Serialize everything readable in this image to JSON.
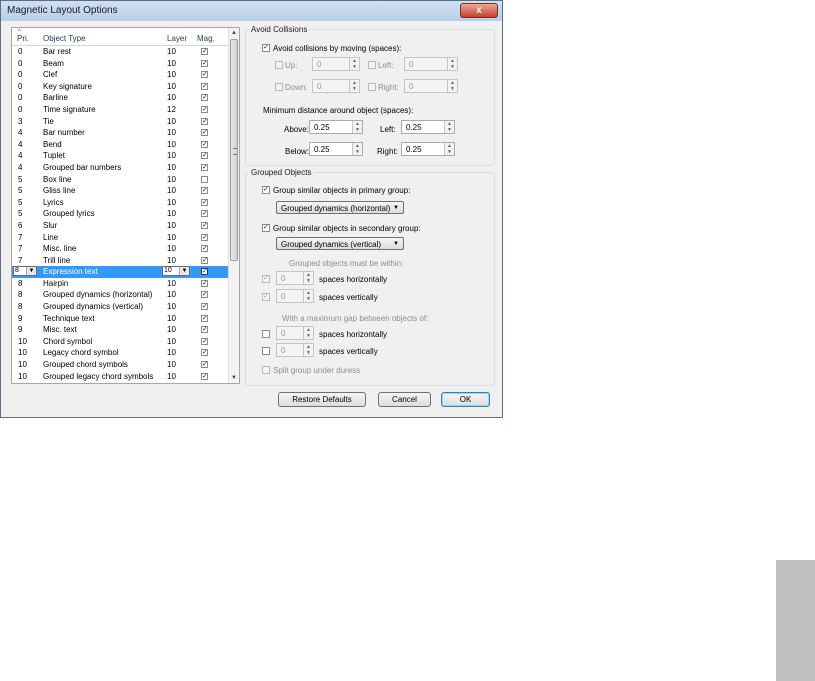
{
  "window": {
    "title": "Magnetic Layout Options",
    "close_glyph": "x"
  },
  "list": {
    "columns": {
      "priority": "Pri.",
      "object_type": "Object Type",
      "layer": "Layer",
      "mag": "Mag."
    },
    "selected_index": 19,
    "rows": [
      {
        "pri": "0",
        "type": "Bar rest",
        "layer": "10",
        "mag": true
      },
      {
        "pri": "0",
        "type": "Beam",
        "layer": "10",
        "mag": true
      },
      {
        "pri": "0",
        "type": "Clef",
        "layer": "10",
        "mag": true
      },
      {
        "pri": "0",
        "type": "Key signature",
        "layer": "10",
        "mag": true
      },
      {
        "pri": "0",
        "type": "Barline",
        "layer": "10",
        "mag": true
      },
      {
        "pri": "0",
        "type": "Time signature",
        "layer": "12",
        "mag": true
      },
      {
        "pri": "3",
        "type": "Tie",
        "layer": "10",
        "mag": true
      },
      {
        "pri": "4",
        "type": "Bar number",
        "layer": "10",
        "mag": true
      },
      {
        "pri": "4",
        "type": "Bend",
        "layer": "10",
        "mag": true
      },
      {
        "pri": "4",
        "type": "Tuplet",
        "layer": "10",
        "mag": true
      },
      {
        "pri": "4",
        "type": "Grouped bar numbers",
        "layer": "10",
        "mag": true
      },
      {
        "pri": "5",
        "type": "Box line",
        "layer": "10",
        "mag": false
      },
      {
        "pri": "5",
        "type": "Gliss line",
        "layer": "10",
        "mag": true
      },
      {
        "pri": "5",
        "type": "Lyrics",
        "layer": "10",
        "mag": true
      },
      {
        "pri": "5",
        "type": "Grouped lyrics",
        "layer": "10",
        "mag": true
      },
      {
        "pri": "6",
        "type": "Slur",
        "layer": "10",
        "mag": true
      },
      {
        "pri": "7",
        "type": "Line",
        "layer": "10",
        "mag": true
      },
      {
        "pri": "7",
        "type": "Misc. line",
        "layer": "10",
        "mag": true
      },
      {
        "pri": "7",
        "type": "Trill line",
        "layer": "10",
        "mag": true
      },
      {
        "pri": "8",
        "type": "Expression text",
        "layer": "10",
        "mag": true
      },
      {
        "pri": "8",
        "type": "Hairpin",
        "layer": "10",
        "mag": true
      },
      {
        "pri": "8",
        "type": "Grouped dynamics (horizontal)",
        "layer": "10",
        "mag": true
      },
      {
        "pri": "8",
        "type": "Grouped dynamics (vertical)",
        "layer": "10",
        "mag": true
      },
      {
        "pri": "9",
        "type": "Technique text",
        "layer": "10",
        "mag": true
      },
      {
        "pri": "9",
        "type": "Misc. text",
        "layer": "10",
        "mag": true
      },
      {
        "pri": "10",
        "type": "Chord symbol",
        "layer": "10",
        "mag": true
      },
      {
        "pri": "10",
        "type": "Legacy chord symbol",
        "layer": "10",
        "mag": true
      },
      {
        "pri": "10",
        "type": "Grouped chord symbols",
        "layer": "10",
        "mag": true
      },
      {
        "pri": "10",
        "type": "Grouped legacy chord symbols",
        "layer": "10",
        "mag": true
      }
    ]
  },
  "avoid_collisions": {
    "title": "Avoid Collisions",
    "moving_label": "Avoid collisions by moving (spaces):",
    "moving_checked": true,
    "up_label": "Up:",
    "up_value": "0",
    "left_label": "Left:",
    "left_value": "0",
    "down_label": "Down:",
    "down_value": "0",
    "right_label": "Right:",
    "right_value": "0",
    "min_distance_label": "Minimum distance around object (spaces):",
    "above_label": "Above:",
    "above_value": "0.25",
    "left2_label": "Left:",
    "left2_value": "0.25",
    "below_label": "Below:",
    "below_value": "0.25",
    "right2_label": "Right:",
    "right2_value": "0.25"
  },
  "grouped_objects": {
    "title": "Grouped Objects",
    "primary_label": "Group similar objects in primary group:",
    "primary_checked": true,
    "primary_value": "Grouped dynamics (horizontal)",
    "secondary_label": "Group similar objects in secondary group:",
    "secondary_checked": true,
    "secondary_value": "Grouped dynamics (vertical)",
    "within_label": "Grouped objects must be within:",
    "within_h_value": "0",
    "within_h_label": "spaces horizontally",
    "within_v_value": "0",
    "within_v_label": "spaces vertically",
    "gap_label": "With a maximum gap between objects of:",
    "gap_h_value": "0",
    "gap_h_label": "spaces horizontally",
    "gap_v_value": "0",
    "gap_v_label": "spaces vertically",
    "split_label": "Split group under duress"
  },
  "buttons": {
    "restore": "Restore Defaults",
    "cancel": "Cancel",
    "ok": "OK"
  },
  "glyphs": {
    "check": "✓",
    "arrow_up": "▲",
    "arrow_down": "▼",
    "sort_up": "^"
  }
}
